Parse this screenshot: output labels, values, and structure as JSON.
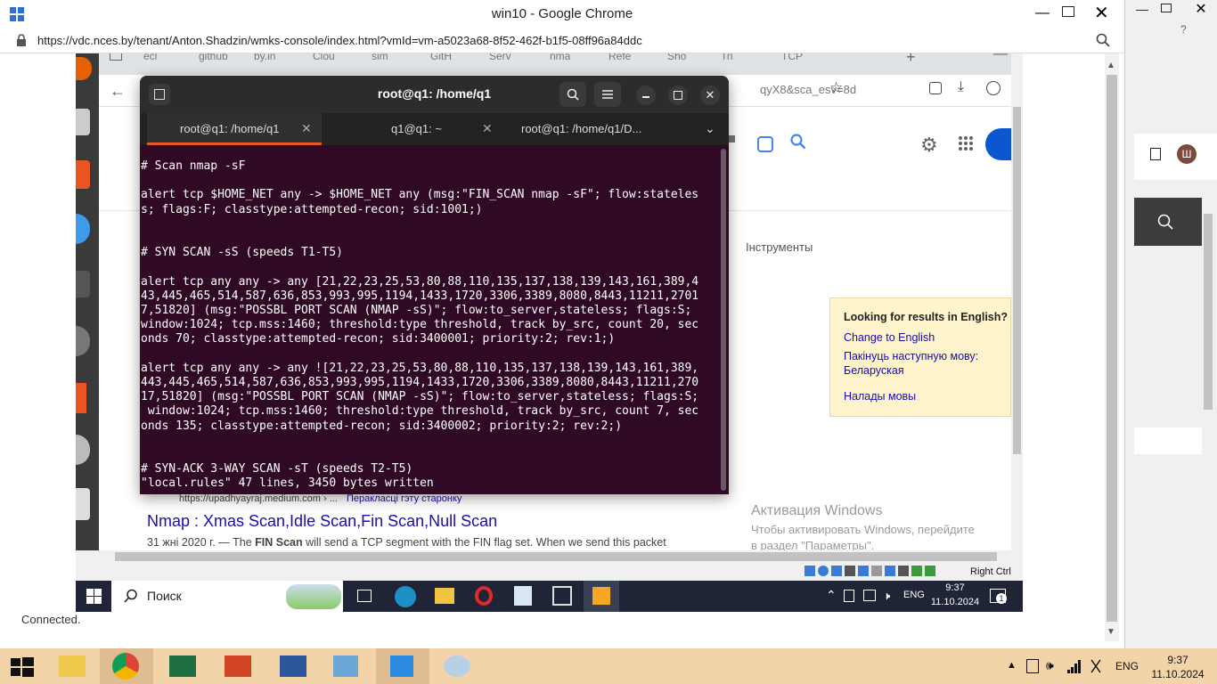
{
  "outer_window": {
    "title": "win10 - Google Chrome",
    "url": "https://vdc.nces.by/tenant/Anton.Shadzin/wmks-console/index.html?vmId=vm-a5023a68-8f52-462f-b1f5-08ff96a84ddc",
    "status": "Connected."
  },
  "guest_chrome": {
    "tabs": [
      "ecl",
      "github",
      "by.in",
      "Clou",
      "sim",
      "GitH",
      "Serv",
      "nma",
      "Refe",
      "Sho",
      "Tri",
      "TCP"
    ],
    "addr_fragment": "qyX8&sca_esv=8d",
    "tools_label": "Інструменты",
    "lang_box": {
      "title": "Looking for results in English?",
      "link1": "Change to English",
      "link2": "Пакінуць наступную мову: Беларуская",
      "link3": "Налады мовы"
    },
    "result": {
      "url": "https://upadhyayraj.medium.com › ...",
      "translate": "Перакласці гэту старонку",
      "title": "Nmap : Xmas Scan,Idle Scan,Fin Scan,Null Scan",
      "snippet_date": "31 жні 2020 г. — The ",
      "snippet_bold": "FIN Scan",
      "snippet_rest": " will send a TCP segment with the FIN flag set. When we send this packet"
    },
    "activation": {
      "title": "Активация Windows",
      "line1": "Чтобы активировать Windows, перейдите",
      "line2": "в раздел \"Параметры\"."
    }
  },
  "terminal": {
    "title": "root@q1: /home/q1",
    "tabs": [
      {
        "label": "root@q1: /home/q1",
        "active": true
      },
      {
        "label": "q1@q1: ~",
        "active": false
      },
      {
        "label": "root@q1: /home/q1/D...",
        "active": false
      }
    ],
    "lines": [
      "# Scan nmap -sF",
      "",
      "alert tcp $HOME_NET any -> $HOME_NET any (msg:\"FIN_SCAN nmap -sF\"; flow:stateles",
      "s; flags:F; classtype:attempted-recon; sid:1001;)",
      "",
      "",
      "# SYN SCAN -sS (speeds T1-T5)",
      "",
      "alert tcp any any -> any [21,22,23,25,53,80,88,110,135,137,138,139,143,161,389,4",
      "43,445,465,514,587,636,853,993,995,1194,1433,1720,3306,3389,8080,8443,11211,2701",
      "7,51820] (msg:\"POSSBL PORT SCAN (NMAP -sS)\"; flow:to_server,stateless; flags:S;",
      "window:1024; tcp.mss:1460; threshold:type threshold, track by_src, count 20, sec",
      "onds 70; classtype:attempted-recon; sid:3400001; priority:2; rev:1;)",
      "",
      "alert tcp any any -> any ![21,22,23,25,53,80,88,110,135,137,138,139,143,161,389,",
      "443,445,465,514,587,636,853,993,995,1194,1433,1720,3306,3389,8080,8443,11211,270",
      "17,51820] (msg:\"POSSBL PORT SCAN (NMAP -sS)\"; flow:to_server,stateless; flags:S;",
      " window:1024; tcp.mss:1460; threshold:type threshold, track by_src, count 7, sec",
      "onds 135; classtype:attempted-recon; sid:3400002; priority:2; rev:2;)",
      "",
      "",
      "# SYN-ACK 3-WAY SCAN -sT (speeds T2-T5)",
      "\"local.rules\" 47 lines, 3450 bytes written"
    ]
  },
  "vbox_status": {
    "host_key": "Right Ctrl"
  },
  "win10_taskbar": {
    "search_placeholder": "Поиск",
    "lang": "ENG",
    "time": "9:37",
    "date": "11.10.2024",
    "notif_count": "1"
  },
  "host_taskbar": {
    "lang": "ENG",
    "time": "9:37",
    "date": "11.10.2024"
  },
  "right_panel": {
    "avatar_letter": "Ш"
  },
  "colors": {
    "terminal_bg": "#300a24",
    "host_taskbar": "#f3d4a8",
    "win10_taskbar": "#1f2436",
    "google_blue": "#1a0dab"
  }
}
